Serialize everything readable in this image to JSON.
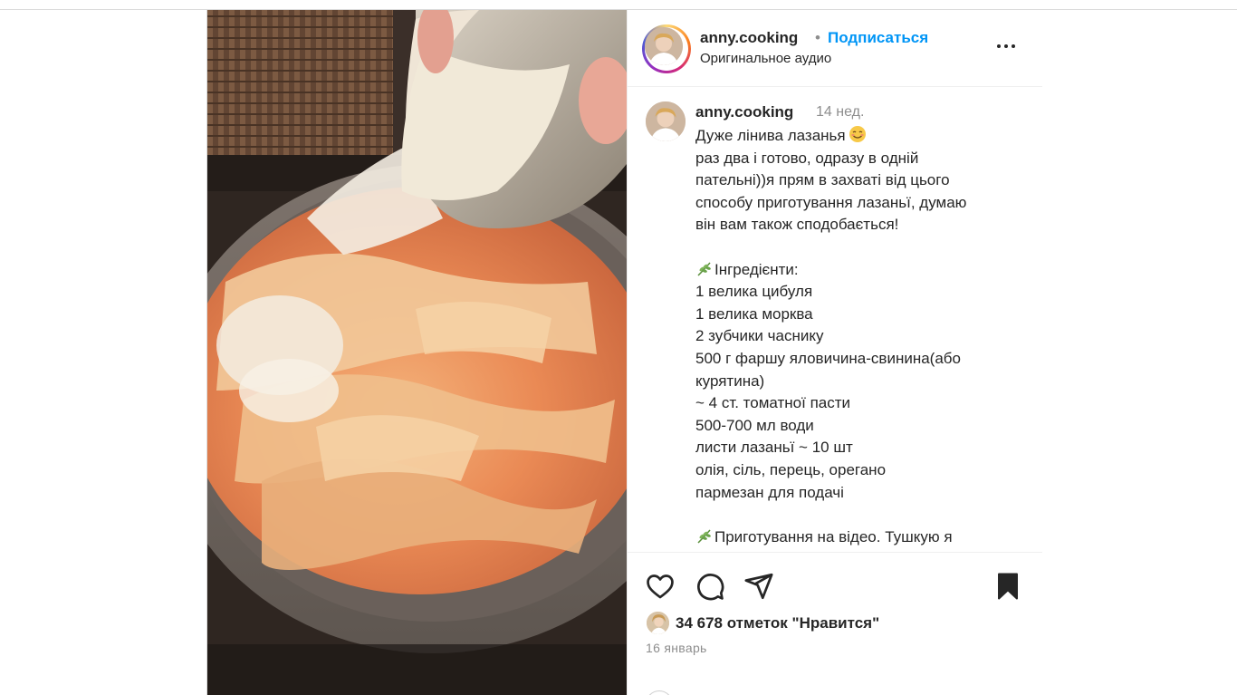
{
  "header": {
    "username": "anny.cooking",
    "separator": "•",
    "follow_label": "Подписаться",
    "audio_label": "Оригинальное аудио"
  },
  "caption": {
    "username": "anny.cooking",
    "time": "14 нед.",
    "lines": [
      "Дуже лінива лазанья",
      "раз два і готово, одразу в одній",
      "пательні))я прям в захваті від цього",
      "способу приготування лазаньї, думаю",
      "він вам також сподобається!",
      "",
      "Інгредієнти:",
      "1 велика цибуля",
      "1 велика морква",
      "2 зубчики часнику",
      "500 г фаршу яловичина-свинина(або",
      "курятина)",
      "~ 4 ст. томатної пасти",
      "500-700 мл води",
      "листи лазаньї ~ 10 шт",
      "олія, сіль, перець, орегано",
      "пармезан для подачі",
      "",
      "Приготування на відео. Тушкую я",
      "..."
    ]
  },
  "actions": {
    "likes_text": "34 678 отметок \"Нравится\"",
    "date": "16 январь"
  },
  "icons": {
    "like": "heart-icon",
    "comment": "comment-icon",
    "share": "share-icon",
    "save": "bookmark-icon",
    "more": "more-icon"
  },
  "colors": {
    "link_blue": "#0095f6",
    "text": "#262626",
    "muted": "#8e8e8e",
    "border": "#dbdbdb"
  }
}
